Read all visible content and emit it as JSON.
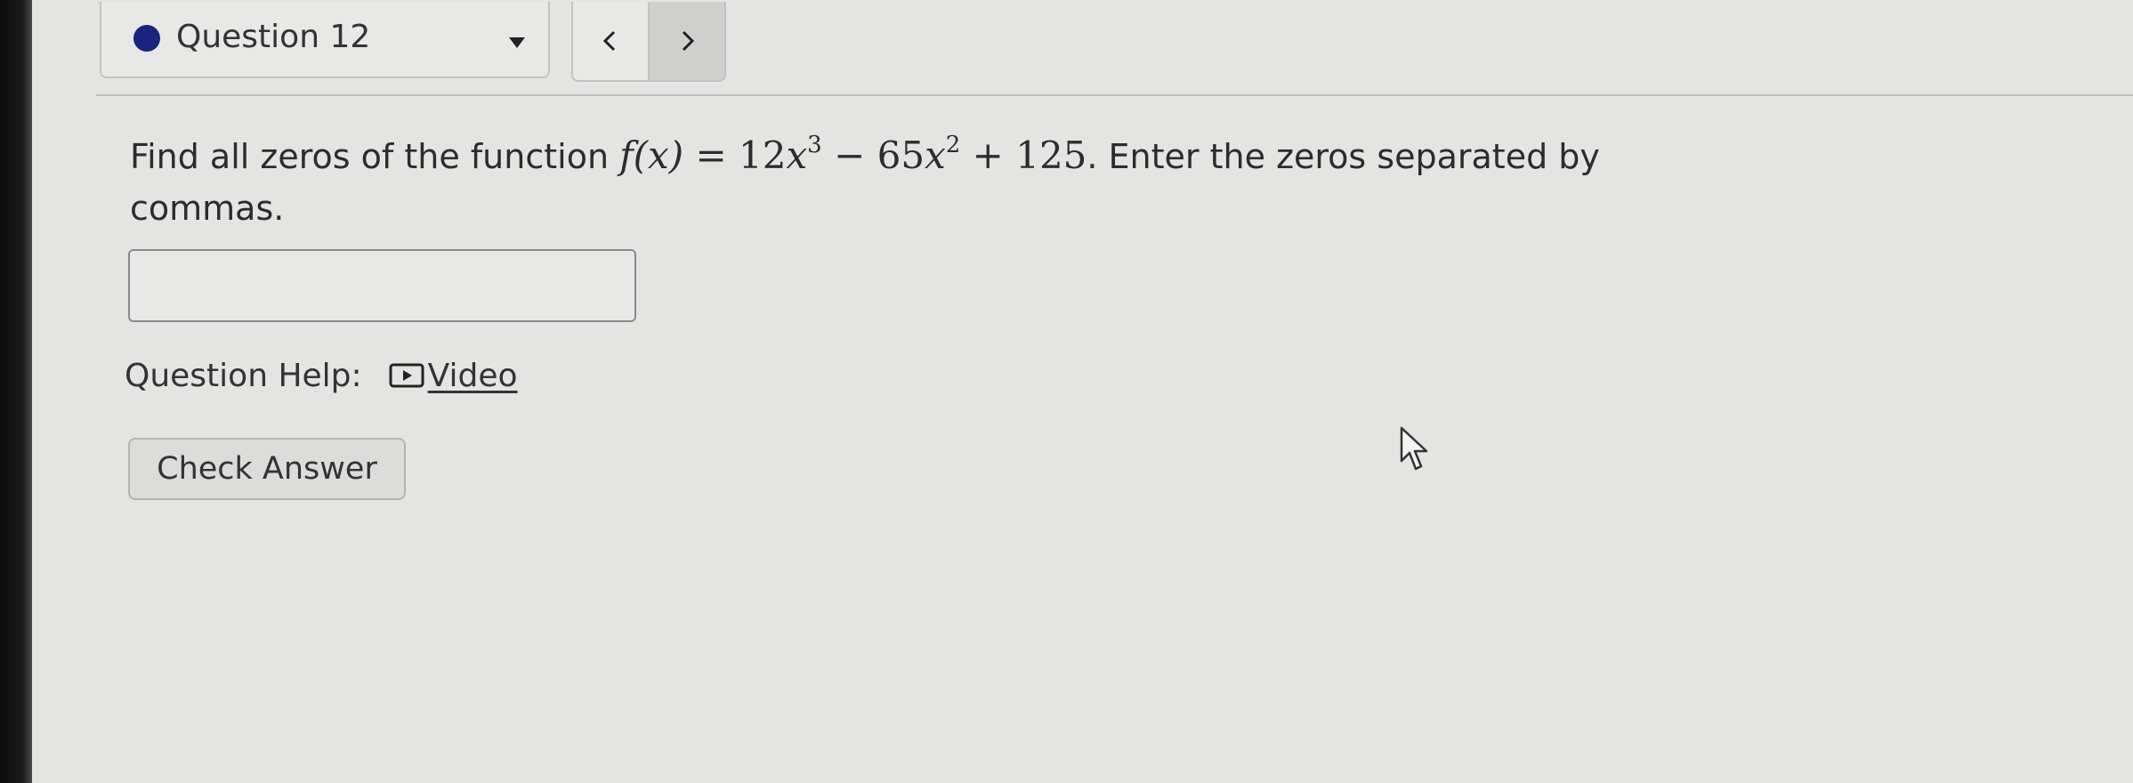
{
  "header": {
    "question_label": "Question 12",
    "status_color": "#1a237e",
    "prev_icon": "chevron-left-icon",
    "next_icon": "chevron-right-icon"
  },
  "question": {
    "text_before": "Find all zeros of the function ",
    "math": {
      "fx": "f(x)",
      "eq": " = ",
      "coef1": "12",
      "var": "x",
      "exp1": "3",
      "minus": " − ",
      "coef2": "65",
      "exp2": "2",
      "plus": " + ",
      "const": "125"
    },
    "text_after": ". Enter the zeros separated by commas."
  },
  "answer": {
    "value": "",
    "placeholder": ""
  },
  "help": {
    "label": "Question Help:",
    "video_icon": "play-icon",
    "video_label": "Video"
  },
  "actions": {
    "check_answer_label": "Check Answer"
  }
}
